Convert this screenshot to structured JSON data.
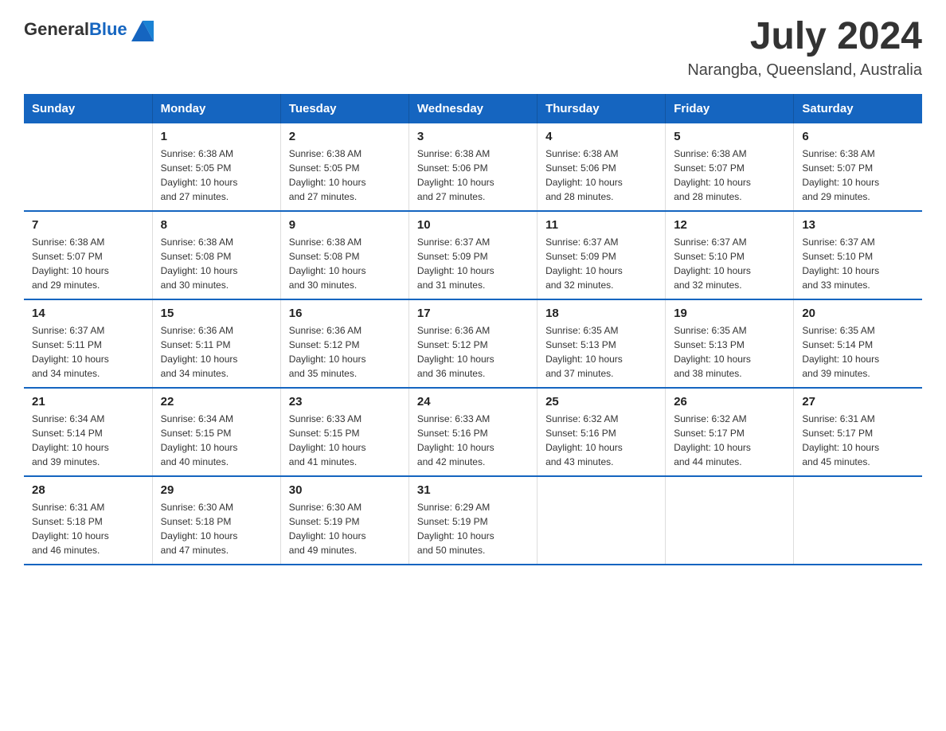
{
  "header": {
    "logo_general": "General",
    "logo_blue": "Blue",
    "month_year": "July 2024",
    "location": "Narangba, Queensland, Australia"
  },
  "days_of_week": [
    "Sunday",
    "Monday",
    "Tuesday",
    "Wednesday",
    "Thursday",
    "Friday",
    "Saturday"
  ],
  "weeks": [
    [
      {
        "day": "",
        "info": ""
      },
      {
        "day": "1",
        "info": "Sunrise: 6:38 AM\nSunset: 5:05 PM\nDaylight: 10 hours\nand 27 minutes."
      },
      {
        "day": "2",
        "info": "Sunrise: 6:38 AM\nSunset: 5:05 PM\nDaylight: 10 hours\nand 27 minutes."
      },
      {
        "day": "3",
        "info": "Sunrise: 6:38 AM\nSunset: 5:06 PM\nDaylight: 10 hours\nand 27 minutes."
      },
      {
        "day": "4",
        "info": "Sunrise: 6:38 AM\nSunset: 5:06 PM\nDaylight: 10 hours\nand 28 minutes."
      },
      {
        "day": "5",
        "info": "Sunrise: 6:38 AM\nSunset: 5:07 PM\nDaylight: 10 hours\nand 28 minutes."
      },
      {
        "day": "6",
        "info": "Sunrise: 6:38 AM\nSunset: 5:07 PM\nDaylight: 10 hours\nand 29 minutes."
      }
    ],
    [
      {
        "day": "7",
        "info": "Sunrise: 6:38 AM\nSunset: 5:07 PM\nDaylight: 10 hours\nand 29 minutes."
      },
      {
        "day": "8",
        "info": "Sunrise: 6:38 AM\nSunset: 5:08 PM\nDaylight: 10 hours\nand 30 minutes."
      },
      {
        "day": "9",
        "info": "Sunrise: 6:38 AM\nSunset: 5:08 PM\nDaylight: 10 hours\nand 30 minutes."
      },
      {
        "day": "10",
        "info": "Sunrise: 6:37 AM\nSunset: 5:09 PM\nDaylight: 10 hours\nand 31 minutes."
      },
      {
        "day": "11",
        "info": "Sunrise: 6:37 AM\nSunset: 5:09 PM\nDaylight: 10 hours\nand 32 minutes."
      },
      {
        "day": "12",
        "info": "Sunrise: 6:37 AM\nSunset: 5:10 PM\nDaylight: 10 hours\nand 32 minutes."
      },
      {
        "day": "13",
        "info": "Sunrise: 6:37 AM\nSunset: 5:10 PM\nDaylight: 10 hours\nand 33 minutes."
      }
    ],
    [
      {
        "day": "14",
        "info": "Sunrise: 6:37 AM\nSunset: 5:11 PM\nDaylight: 10 hours\nand 34 minutes."
      },
      {
        "day": "15",
        "info": "Sunrise: 6:36 AM\nSunset: 5:11 PM\nDaylight: 10 hours\nand 34 minutes."
      },
      {
        "day": "16",
        "info": "Sunrise: 6:36 AM\nSunset: 5:12 PM\nDaylight: 10 hours\nand 35 minutes."
      },
      {
        "day": "17",
        "info": "Sunrise: 6:36 AM\nSunset: 5:12 PM\nDaylight: 10 hours\nand 36 minutes."
      },
      {
        "day": "18",
        "info": "Sunrise: 6:35 AM\nSunset: 5:13 PM\nDaylight: 10 hours\nand 37 minutes."
      },
      {
        "day": "19",
        "info": "Sunrise: 6:35 AM\nSunset: 5:13 PM\nDaylight: 10 hours\nand 38 minutes."
      },
      {
        "day": "20",
        "info": "Sunrise: 6:35 AM\nSunset: 5:14 PM\nDaylight: 10 hours\nand 39 minutes."
      }
    ],
    [
      {
        "day": "21",
        "info": "Sunrise: 6:34 AM\nSunset: 5:14 PM\nDaylight: 10 hours\nand 39 minutes."
      },
      {
        "day": "22",
        "info": "Sunrise: 6:34 AM\nSunset: 5:15 PM\nDaylight: 10 hours\nand 40 minutes."
      },
      {
        "day": "23",
        "info": "Sunrise: 6:33 AM\nSunset: 5:15 PM\nDaylight: 10 hours\nand 41 minutes."
      },
      {
        "day": "24",
        "info": "Sunrise: 6:33 AM\nSunset: 5:16 PM\nDaylight: 10 hours\nand 42 minutes."
      },
      {
        "day": "25",
        "info": "Sunrise: 6:32 AM\nSunset: 5:16 PM\nDaylight: 10 hours\nand 43 minutes."
      },
      {
        "day": "26",
        "info": "Sunrise: 6:32 AM\nSunset: 5:17 PM\nDaylight: 10 hours\nand 44 minutes."
      },
      {
        "day": "27",
        "info": "Sunrise: 6:31 AM\nSunset: 5:17 PM\nDaylight: 10 hours\nand 45 minutes."
      }
    ],
    [
      {
        "day": "28",
        "info": "Sunrise: 6:31 AM\nSunset: 5:18 PM\nDaylight: 10 hours\nand 46 minutes."
      },
      {
        "day": "29",
        "info": "Sunrise: 6:30 AM\nSunset: 5:18 PM\nDaylight: 10 hours\nand 47 minutes."
      },
      {
        "day": "30",
        "info": "Sunrise: 6:30 AM\nSunset: 5:19 PM\nDaylight: 10 hours\nand 49 minutes."
      },
      {
        "day": "31",
        "info": "Sunrise: 6:29 AM\nSunset: 5:19 PM\nDaylight: 10 hours\nand 50 minutes."
      },
      {
        "day": "",
        "info": ""
      },
      {
        "day": "",
        "info": ""
      },
      {
        "day": "",
        "info": ""
      }
    ]
  ]
}
